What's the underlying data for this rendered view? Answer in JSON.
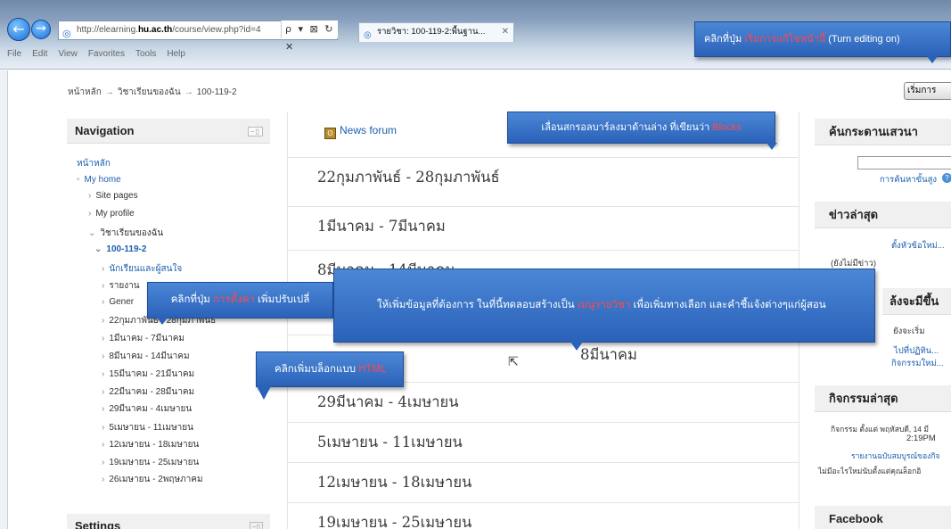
{
  "browser": {
    "address": {
      "prefix": "http://elearning.",
      "domain": "hu.ac.th",
      "path": "/course/view.php?id=4",
      "tools": "ρ ▾ ⊠ ↻ ✕"
    },
    "tab": {
      "title": "รายวิชา: 100-119-2:พื้นฐาน...",
      "close": "✕"
    },
    "menu": [
      "File",
      "Edit",
      "View",
      "Favorites",
      "Tools",
      "Help"
    ]
  },
  "breadcrumb": [
    "หน้าหลัก",
    "วิชาเรียนของฉัน",
    "100-119-2"
  ],
  "breadcrumb_sep": "→",
  "edit_button": "เริ่มการ",
  "navigation": {
    "title": "Navigation",
    "items": [
      {
        "label": "หน้าหลัก"
      },
      {
        "label": "My home",
        "prefix": "▫"
      },
      {
        "label": "Site pages",
        "prefix": "›"
      },
      {
        "label": "My profile",
        "prefix": "›"
      },
      {
        "label": "วิชาเรียนของฉัน",
        "prefix": "⌄"
      },
      {
        "label": "100-119-2",
        "prefix": "⌄"
      },
      {
        "label": "นักเรียนและผู้สนใจ",
        "prefix": "›"
      },
      {
        "label": "รายงาน",
        "prefix": "›"
      },
      {
        "label": "Gener",
        "prefix": "›"
      },
      {
        "label": "22กุมภาพันธ์ - 28กุมภาพันธ์",
        "prefix": "›"
      },
      {
        "label": "1มีนาคม - 7มีนาคม",
        "prefix": "›"
      },
      {
        "label": "8มีนาคม - 14มีนาคม",
        "prefix": "›"
      },
      {
        "label": "15มีนาคม - 21มีนาคม",
        "prefix": "›"
      },
      {
        "label": "22มีนาคม - 28มีนาคม",
        "prefix": "›"
      },
      {
        "label": "29มีนาคม - 4เมษายน",
        "prefix": "›"
      },
      {
        "label": "5เมษายน - 11เมษายน",
        "prefix": "›"
      },
      {
        "label": "12เมษายน - 18เมษายน",
        "prefix": "›"
      },
      {
        "label": "19เมษายน - 25เมษายน",
        "prefix": "›"
      },
      {
        "label": "26เมษายน - 2พฤษภาคม",
        "prefix": "›"
      }
    ]
  },
  "settings": {
    "title": "Settings"
  },
  "center": {
    "news_forum": "News forum",
    "weeks": [
      "22กุมภาพันธ์ - 28กุมภาพันธ์",
      "1มีนาคม - 7มีนาคม",
      "8มีนาคม - 14มีนาคม",
      "",
      "8มีนาคม",
      "29มีนาคม - 4เมษายน",
      "5เมษายน - 11เมษายน",
      "12เมษายน - 18เมษายน",
      "19เมษายน - 25เมษายน"
    ]
  },
  "right": {
    "search": {
      "title": "ค้นกระดานเสวนา",
      "advanced": "การค้นหาขั้นสูง"
    },
    "news": {
      "title": "ข่าวล่าสุด",
      "add": "ตั้งหัวข้อใหม่...",
      "empty": "(ยังไม่มีข่าว)"
    },
    "upcoming": {
      "title": "ล้งจะมีขึ้น",
      "none": "ยังจะเริ่ม",
      "goto": "ไปที่ปฏิทิน...",
      "new": "กิจกรรมใหม่..."
    },
    "recent": {
      "title": "กิจกรรมล่าสุด",
      "since": "กิจกรรม ตั้งแต่ พฤหัสบดี, 14 มี",
      "time": "2:19PM",
      "report": "รายงานฉบับสมบูรณ์ของกิจ",
      "nothing": "ไม่มีอะไรใหม่นับตั้งแต่คุณล็อกอิ"
    },
    "facebook": {
      "title": "Facebook"
    }
  },
  "callouts": {
    "edit": {
      "pre": "คลิกที่ปุ่ม ",
      "hl": "เริ่มการแก้ไขหน้านี้",
      "post": " (Turn editing on)"
    },
    "blocks": {
      "pre": "เลื่อนสกรอลบาร์ลงมาด้านล่าง  ที่เขียนว่า ",
      "hl": "Blocks"
    },
    "setting": {
      "pre": "คลิกที่ปุ่ม ",
      "hl": "การตั้งค่า",
      "post": " เพิ่มปรับเปลี่"
    },
    "info": {
      "pre": "ให้เพิ่มข้อมูลที่ต้องการ  ในที่นี้ทดลอบสร้างเป็น  ",
      "hl": "เมนูรายวิชา",
      "post": "  เพื่อเพิ่มทางเลือก  และคำชี้แจ้งต่างๆแก่ผู้สอน"
    },
    "html": {
      "pre": "คลิกเพิ่มบล็อกแบบ ",
      "hl": "HTML"
    }
  },
  "colors": {
    "callout": "#2a62b9",
    "highlight": "#ff4a4a",
    "link": "#1a5fae"
  }
}
